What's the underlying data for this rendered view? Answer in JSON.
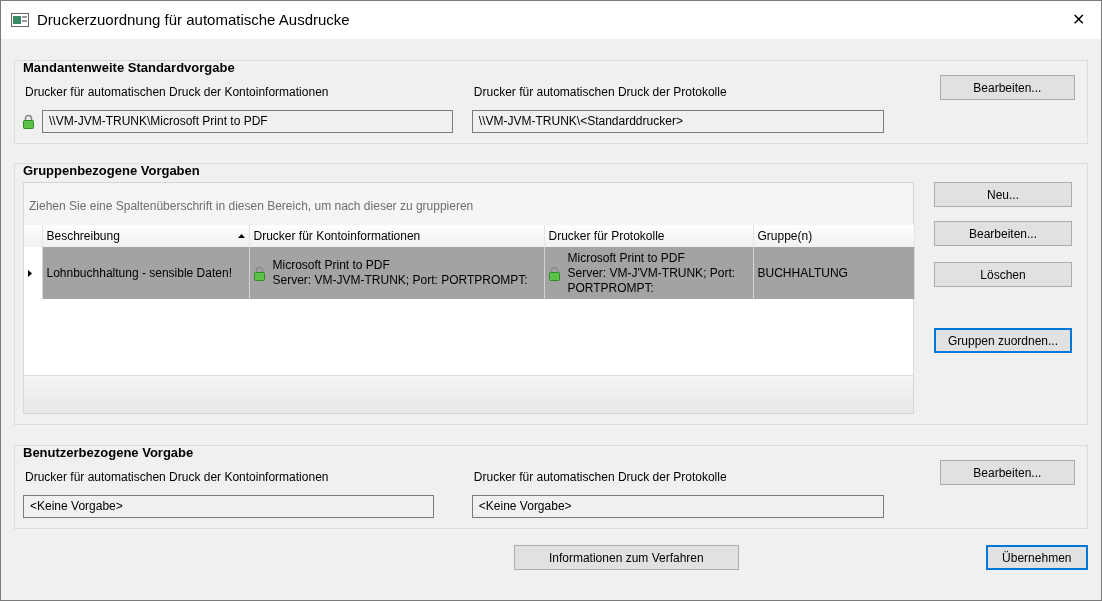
{
  "window": {
    "title": "Druckerzuordnung für automatische Ausdrucke",
    "close": "✕"
  },
  "client_defaults": {
    "title": "Mandantenweite Standardvorgabe",
    "fields": [
      {
        "label": "Drucker für automatischen Druck der Kontoinformationen",
        "value": "\\\\VM-JVM-TRUNK\\Microsoft Print to PDF",
        "locked": true
      },
      {
        "label": "Drucker für automatischen Druck der Protokolle",
        "value": "\\\\VM-JVM-TRUNK\\<Standarddrucker>",
        "locked": false
      }
    ],
    "button": {
      "label": "Bearbeiten...",
      "focused": false
    }
  },
  "group_defaults": {
    "title": "Gruppenbezogene Vorgaben",
    "group_hint": "Ziehen Sie eine Spaltenüberschrift in diesen Bereich, um nach dieser zu gruppieren",
    "table": {
      "columns": [
        {
          "label": "Beschreibung",
          "sorted": true
        },
        {
          "label": "Drucker für Kontoinformationen",
          "sorted": false
        },
        {
          "label": "Drucker für Protokolle",
          "sorted": false
        },
        {
          "label": "Gruppe(n)",
          "sorted": false
        }
      ],
      "rows": [
        {
          "selected": true,
          "cells": [
            {
              "text": "Lohnbuchhaltung - sensible Daten!",
              "locked": false
            },
            {
              "text": "Microsoft Print to PDF\nServer: VM-JVM-TRUNK; Port: PORTPROMPT:",
              "locked": true
            },
            {
              "text": "Microsoft Print to PDF\nServer: VM-J'VM-TRUNK; Port:\nPORTPROMPT:",
              "locked": true
            },
            {
              "text": "BUCHHALTUNG",
              "locked": false
            }
          ]
        }
      ]
    },
    "buttons": [
      {
        "label": "Neu...",
        "focused": false
      },
      {
        "label": "Bearbeiten...",
        "focused": false
      },
      {
        "label": "Löschen",
        "focused": false
      },
      {
        "label": "Gruppen zuordnen...",
        "focused": true
      }
    ]
  },
  "user_defaults": {
    "title": "Benutzerbezogene Vorgabe",
    "fields": [
      {
        "label": "Drucker für automatischen Druck der Kontoinformationen",
        "value": "<Keine Vorgabe>",
        "locked": false
      },
      {
        "label": "Drucker für automatischen Druck der Protokolle",
        "value": "<Keine Vorgabe>",
        "locked": false
      }
    ],
    "button": {
      "label": "Bearbeiten...",
      "focused": false
    }
  },
  "footer_buttons": [
    {
      "label": "Informationen zum Verfahren",
      "focused": false
    },
    {
      "label": "Übernehmen",
      "focused": true
    }
  ]
}
